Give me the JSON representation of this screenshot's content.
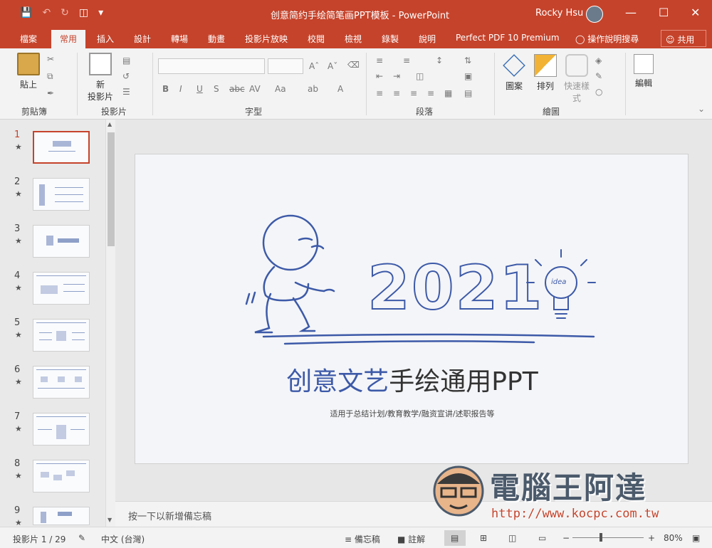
{
  "window": {
    "title": "创意简约手绘简笔画PPT模板 - PowerPoint",
    "user": "Rocky Hsu"
  },
  "ribbon_tabs": [
    "檔案",
    "常用",
    "插入",
    "設計",
    "轉場",
    "動畫",
    "投影片放映",
    "校閱",
    "檢視",
    "錄製",
    "說明",
    "Perfect PDF 10 Premium"
  ],
  "tell_me": "操作說明搜尋",
  "share": "共用",
  "ribbon": {
    "paste_label": "貼上",
    "clipboard_group": "剪貼簿",
    "new_slide_label": "新",
    "new_slide_label2": "投影片",
    "slides_group": "投影片",
    "font_group": "字型",
    "paragraph_group": "段落",
    "drawing_group": "繪圖",
    "shapes_label": "圖案",
    "arrange_label": "排列",
    "quick_styles_label": "快速樣",
    "quick_styles_label2": "式",
    "editing_label": "編輯"
  },
  "thumbnails": [
    {
      "num": "1"
    },
    {
      "num": "2"
    },
    {
      "num": "3"
    },
    {
      "num": "4"
    },
    {
      "num": "5"
    },
    {
      "num": "6"
    },
    {
      "num": "7"
    },
    {
      "num": "8"
    },
    {
      "num": "9"
    }
  ],
  "slide": {
    "year": "2021",
    "idea": "idea",
    "title_blue": "创意文艺",
    "title_dark": "手绘通用PPT",
    "subtitle": "适用于总结计划/教育教学/融资宣讲/述职报告等"
  },
  "notes_placeholder": "按一下以新增備忘稿",
  "watermark": {
    "text": "電腦王阿達",
    "url": "http://www.kocpc.com.tw"
  },
  "status": {
    "slide_counter": "投影片 1 / 29",
    "language": "中文 (台灣)",
    "notes_btn": "備忘稿",
    "comments_btn": "註解",
    "zoom": "80%"
  },
  "colors": {
    "accent": "#c5432b",
    "slide_blue": "#3d5aa8"
  }
}
